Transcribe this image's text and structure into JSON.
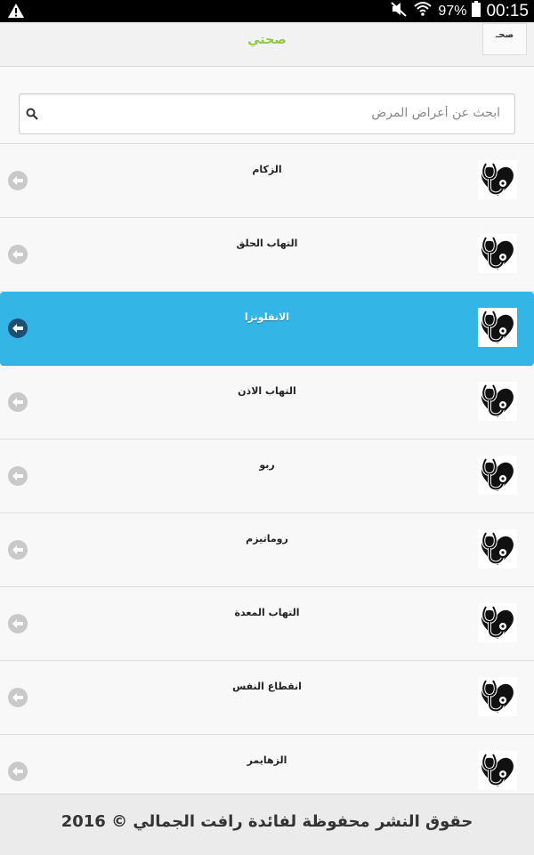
{
  "status_bar": {
    "battery": "97%",
    "time": "00:15",
    "icons": [
      "warning-icon",
      "mute-icon",
      "wifi-icon",
      "battery-icon"
    ]
  },
  "app_bar": {
    "title": "صحتي",
    "logo_text": "صحـ"
  },
  "search": {
    "placeholder": "ابحث عن أعراض المرض",
    "value": ""
  },
  "diseases": [
    {
      "label": "الزكام"
    },
    {
      "label": "التهاب الحلق"
    },
    {
      "label": "الانفلونزا",
      "selected": true
    },
    {
      "label": "التهاب الاذن"
    },
    {
      "label": "ربو"
    },
    {
      "label": "روماتيزم"
    },
    {
      "label": "التهاب المعدة"
    },
    {
      "label": "انقطاع النفس"
    },
    {
      "label": "الزهايمر"
    }
  ],
  "footer": {
    "copyright": "حقوق النشر محفوظة لفائدة رافت الجمالي © 2016"
  },
  "colors": {
    "accent_title": "#8dc73f",
    "selected_row": "#33b5e5",
    "status_bar": "#000000"
  }
}
